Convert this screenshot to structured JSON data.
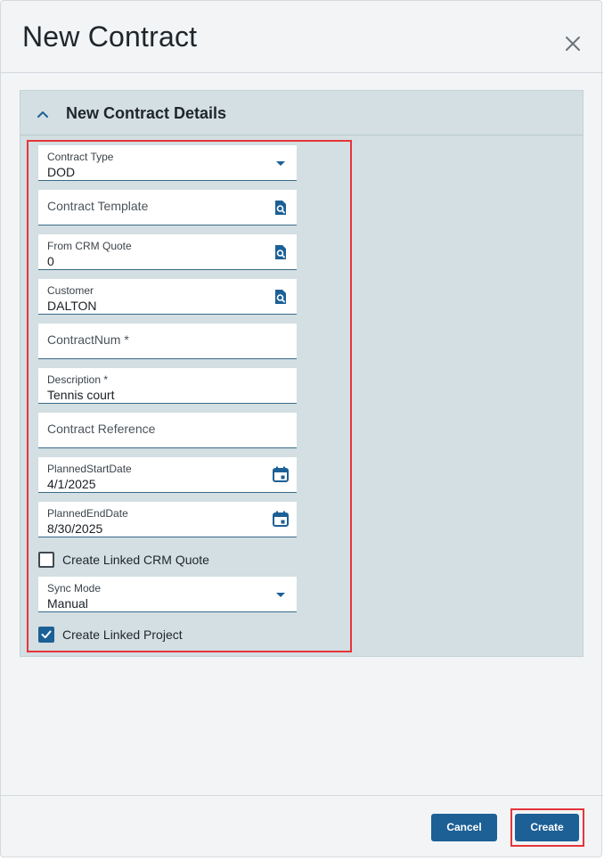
{
  "dialog": {
    "title": "New Contract",
    "close_icon": "close-icon"
  },
  "section": {
    "title": "New Contract Details",
    "toggle_icon": "chevron-up-icon"
  },
  "fields": {
    "contract_type": {
      "label": "Contract Type",
      "value": "DOD",
      "icon": "caret-down-icon"
    },
    "contract_template": {
      "placeholder": "Contract Template",
      "icon": "search-icon"
    },
    "from_crm_quote": {
      "label": "From CRM Quote",
      "value": "0",
      "icon": "search-icon"
    },
    "customer": {
      "label": "Customer",
      "value": "DALTON",
      "icon": "search-icon"
    },
    "contract_num": {
      "placeholder": "ContractNum *"
    },
    "description": {
      "label": "Description *",
      "value": "Tennis court"
    },
    "contract_reference": {
      "placeholder": "Contract Reference"
    },
    "planned_start_date": {
      "label": "PlannedStartDate",
      "value": "4/1/2025",
      "icon": "calendar-icon"
    },
    "planned_end_date": {
      "label": "PlannedEndDate",
      "value": "8/30/2025",
      "icon": "calendar-icon"
    },
    "sync_mode": {
      "label": "Sync Mode",
      "value": "Manual",
      "icon": "caret-down-icon"
    }
  },
  "checkboxes": {
    "create_linked_crm_quote": {
      "label": "Create Linked CRM Quote",
      "checked": false
    },
    "create_linked_project": {
      "label": "Create Linked Project",
      "checked": true
    }
  },
  "footer": {
    "cancel_label": "Cancel",
    "create_label": "Create"
  },
  "colors": {
    "accent": "#1c6096",
    "section_bg": "#d3dfe2",
    "highlight": "#e5353a"
  }
}
